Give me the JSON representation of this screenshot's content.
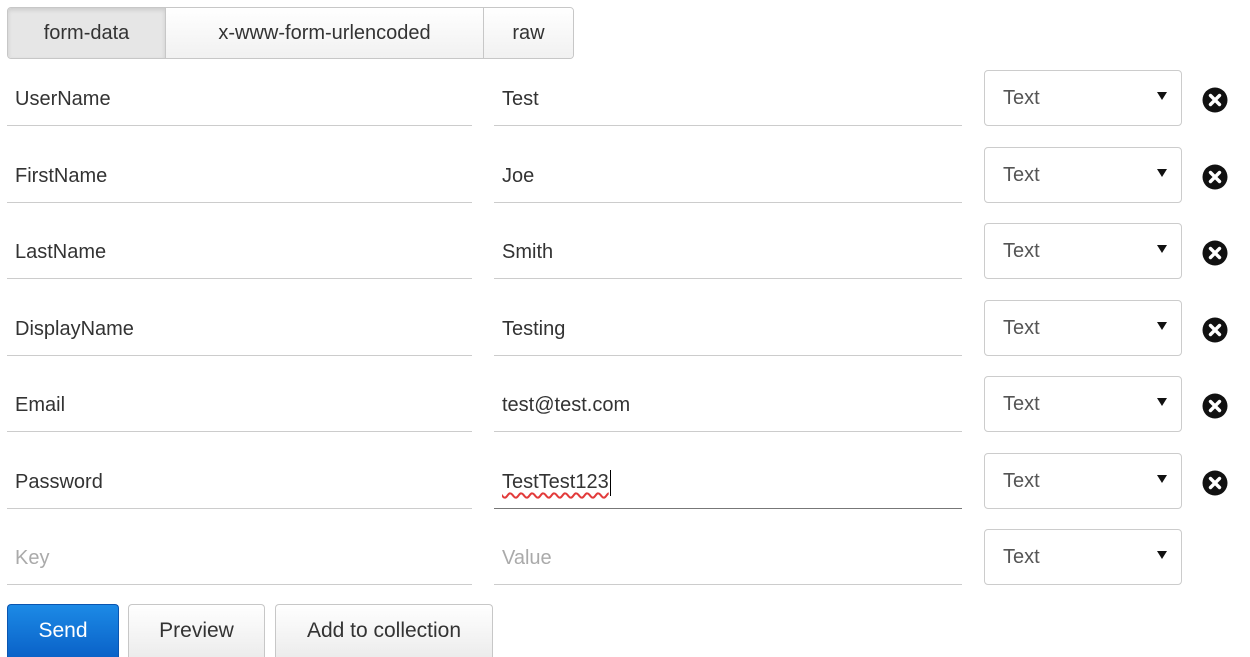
{
  "tabs": [
    {
      "label": "form-data",
      "active": true
    },
    {
      "label": "x-www-form-urlencoded",
      "active": false
    },
    {
      "label": "raw",
      "active": false
    }
  ],
  "rows": [
    {
      "key": "UserName",
      "value": "Test",
      "type": "Text"
    },
    {
      "key": "FirstName",
      "value": "Joe",
      "type": "Text"
    },
    {
      "key": "LastName",
      "value": "Smith",
      "type": "Text"
    },
    {
      "key": "DisplayName",
      "value": "Testing",
      "type": "Text"
    },
    {
      "key": "Email",
      "value": "test@test.com",
      "type": "Text"
    },
    {
      "key": "Password",
      "value": "TestTest123",
      "type": "Text"
    }
  ],
  "new_row": {
    "key_placeholder": "Key",
    "value_placeholder": "Value",
    "type": "Text"
  },
  "buttons": {
    "send": "Send",
    "preview": "Preview",
    "add_to_collection": "Add to collection"
  },
  "icons": {
    "remove": "close-circle-icon"
  },
  "colors": {
    "send_button": "#0a62c8",
    "remove_icon": "#111111"
  }
}
